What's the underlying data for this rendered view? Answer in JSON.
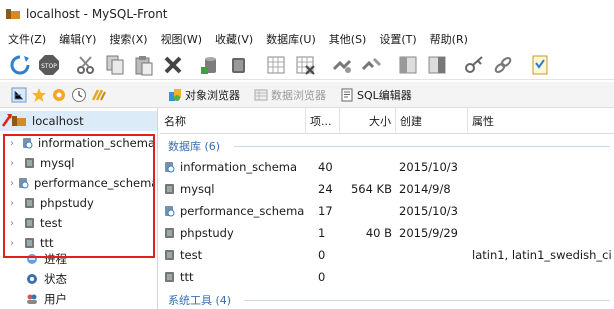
{
  "window": {
    "title": "localhost - MySQL-Front"
  },
  "menu": [
    "文件(Z)",
    "编辑(Y)",
    "搜索(X)",
    "视图(W)",
    "收藏(V)",
    "数据库(U)",
    "其他(S)",
    "设置(T)",
    "帮助(R)"
  ],
  "toolbar": {
    "icons": [
      "refresh-icon",
      "stop-icon",
      "cut-icon",
      "copy-icon",
      "paste-icon",
      "delete-icon",
      "new-database-icon",
      "new-table-icon",
      "grid-icon",
      "grid-delete-icon",
      "connect-icon",
      "disconnect-icon",
      "import-icon",
      "export-icon",
      "key-icon",
      "link-icon",
      "notes-icon"
    ]
  },
  "view_tabs": [
    {
      "label": "对象浏览器",
      "active": true
    },
    {
      "label": "数据浏览器",
      "active": false
    },
    {
      "label": "SQL编辑器",
      "active": false
    }
  ],
  "tree": {
    "root": "localhost",
    "databases": [
      "information_schema",
      "mysql",
      "performance_schema",
      "phpstudy",
      "test",
      "ttt"
    ],
    "extras": [
      "进程",
      "状态",
      "用户"
    ]
  },
  "grid": {
    "columns": [
      "名称",
      "项...",
      "大小",
      "创建",
      "属性"
    ],
    "groups": {
      "databases": "数据库 (6)",
      "tools": "系统工具 (4)"
    },
    "rows": [
      {
        "name": "information_schema",
        "items": "40",
        "size": "",
        "created": "2015/10/3",
        "attrs": ""
      },
      {
        "name": "mysql",
        "items": "24",
        "size": "564 KB",
        "created": "2014/9/8",
        "attrs": ""
      },
      {
        "name": "performance_schema",
        "items": "17",
        "size": "",
        "created": "2015/10/3",
        "attrs": ""
      },
      {
        "name": "phpstudy",
        "items": "1",
        "size": "40 B",
        "created": "2015/9/29",
        "attrs": ""
      },
      {
        "name": "test",
        "items": "0",
        "size": "",
        "created": "",
        "attrs": "latin1, latin1_swedish_ci"
      },
      {
        "name": "ttt",
        "items": "0",
        "size": "",
        "created": "",
        "attrs": ""
      }
    ]
  },
  "colors": {
    "highlight_border": "#e01f1f",
    "tree_selection": "#dcebf8",
    "group_label": "#3a6fb0"
  }
}
